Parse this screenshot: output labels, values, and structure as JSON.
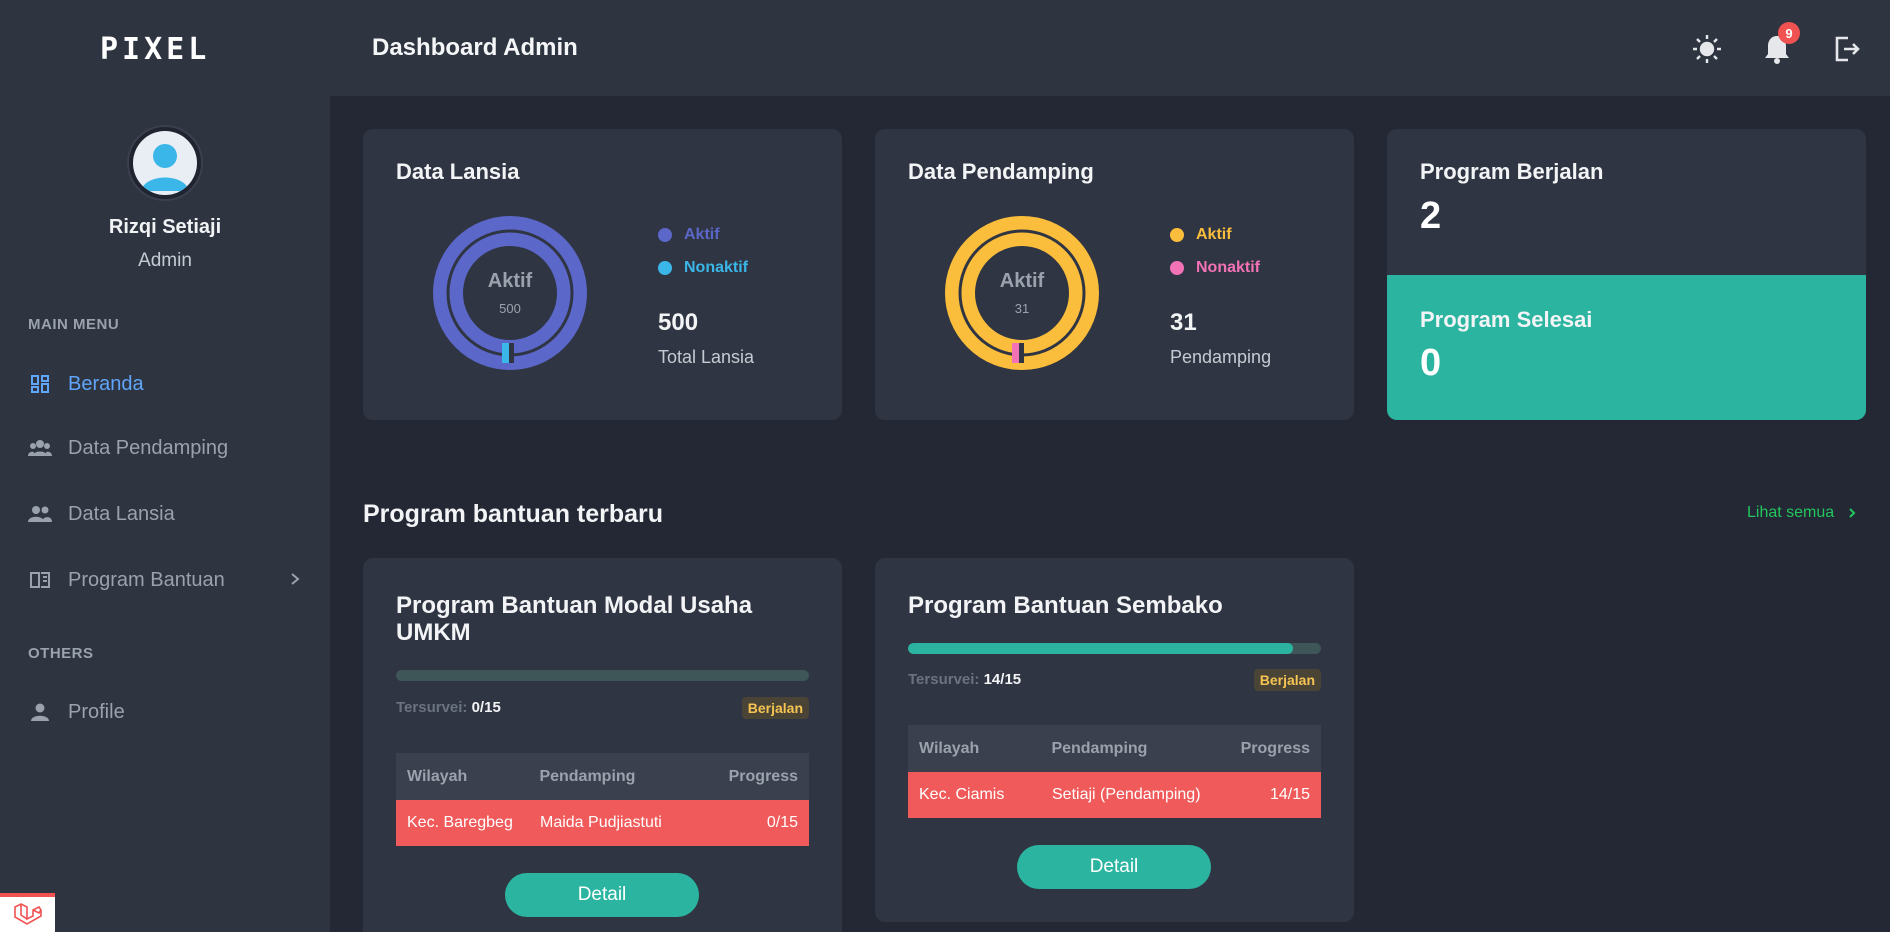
{
  "app": {
    "logo_text": "PIXEL"
  },
  "user": {
    "name": "Rizqi Setiaji",
    "role": "Admin"
  },
  "sidebar": {
    "main_label": "MAIN MENU",
    "others_label": "OTHERS",
    "items": [
      {
        "label": "Beranda",
        "icon": "dashboard-grid-icon",
        "active": true
      },
      {
        "label": "Data Pendamping",
        "icon": "group-icon"
      },
      {
        "label": "Data Lansia",
        "icon": "people-icon"
      },
      {
        "label": "Program Bantuan",
        "icon": "book-icon"
      }
    ],
    "others": [
      {
        "label": "Profile",
        "icon": "person-icon"
      }
    ]
  },
  "header": {
    "title": "Dashboard Admin",
    "notification_count": "9",
    "icons": [
      "sun-icon",
      "bell-icon",
      "logout-icon"
    ]
  },
  "stats": {
    "lansia": {
      "title": "Data Lansia",
      "center_label": "Aktif",
      "center_value": "500",
      "legend": [
        {
          "label": "Aktif",
          "color": "#5b67c9"
        },
        {
          "label": "Nonaktif",
          "color": "#3bb6e8"
        }
      ],
      "total": "500",
      "total_label": "Total Lansia",
      "aktif": 500,
      "nonaktif": 0
    },
    "pendamping": {
      "title": "Data Pendamping",
      "center_label": "Aktif",
      "center_value": "31",
      "legend": [
        {
          "label": "Aktif",
          "color": "#fbbd3c"
        },
        {
          "label": "Nonaktif",
          "color": "#f472b6"
        }
      ],
      "total": "31",
      "total_label": "Pendamping",
      "aktif": 31,
      "nonaktif": 0
    },
    "program_berjalan": {
      "label": "Program Berjalan",
      "value": "2"
    },
    "program_selesai": {
      "label": "Program Selesai",
      "value": "0",
      "color": "#2bb5a0"
    }
  },
  "programs_section": {
    "title": "Program bantuan terbaru",
    "see_all": "Lihat semua"
  },
  "programs": [
    {
      "title": "Program Bantuan Modal Usaha UMKM",
      "progress": 0.0,
      "tersurvei_label": "Tersurvei:",
      "tersurvei_value": "0/15",
      "status": "Berjalan",
      "columns": [
        "Wilayah",
        "Pendamping",
        "Progress"
      ],
      "rows": [
        [
          "Kec. Baregbeg",
          "Maida Pudjiastuti",
          "0/15"
        ]
      ],
      "button": "Detail"
    },
    {
      "title": "Program Bantuan Sembako",
      "progress": 0.933,
      "tersurvei_label": "Tersurvei:",
      "tersurvei_value": "14/15",
      "status": "Berjalan",
      "columns": [
        "Wilayah",
        "Pendamping",
        "Progress"
      ],
      "rows": [
        [
          "Kec. Ciamis",
          "Setiaji (Pendamping)",
          "14/15"
        ]
      ],
      "button": "Detail"
    }
  ]
}
